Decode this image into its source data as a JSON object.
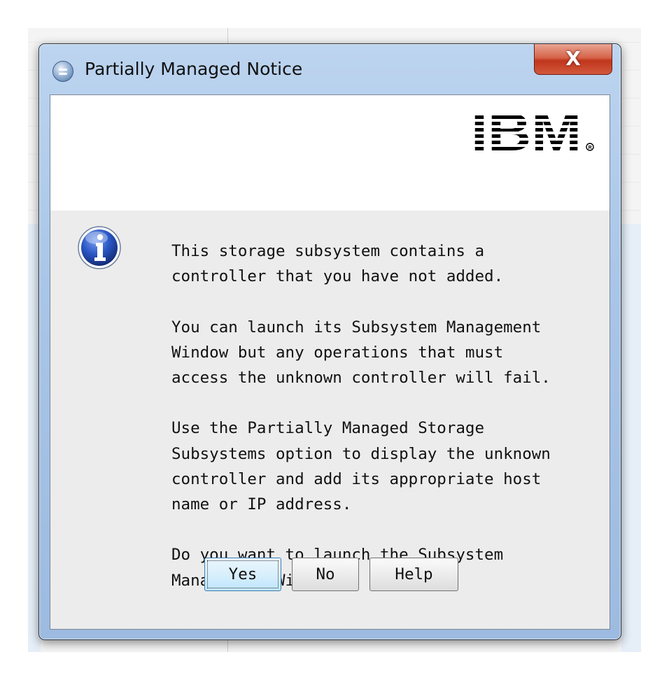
{
  "dialog": {
    "title": "Partially Managed Notice",
    "close_label": "X",
    "logo_text": "IBM",
    "message": [
      "This storage subsystem contains a\ncontroller that you have not added.",
      "You can launch its Subsystem Management\nWindow but any operations that must\naccess the unknown controller will fail.",
      "Use the Partially Managed Storage\nSubsystems option to display the unknown\ncontroller and add its appropriate host\nname or IP address.",
      "Do you want to launch the Subsystem\nManagement Window?"
    ],
    "buttons": {
      "yes": "Yes",
      "no": "No",
      "help": "Help"
    }
  },
  "icons": {
    "title": "database-icon",
    "info": "info-icon",
    "close": "close-icon"
  },
  "colors": {
    "titlebar": "#a9c6e8",
    "close_button": "#c0361c",
    "client_bg": "#ececec",
    "info_icon": "#1a3f9e"
  }
}
